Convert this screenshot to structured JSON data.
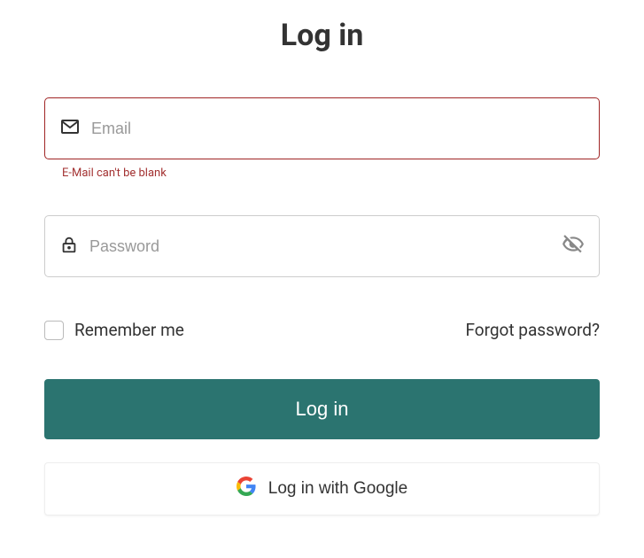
{
  "title": "Log in",
  "email": {
    "placeholder": "Email",
    "value": "",
    "error": "E-Mail can't be blank"
  },
  "password": {
    "placeholder": "Password",
    "value": ""
  },
  "remember": {
    "label": "Remember me",
    "checked": false
  },
  "forgot": "Forgot password?",
  "submit": "Log in",
  "google": "Log in with Google",
  "colors": {
    "primary": "#2b7470",
    "error": "#a33232"
  }
}
